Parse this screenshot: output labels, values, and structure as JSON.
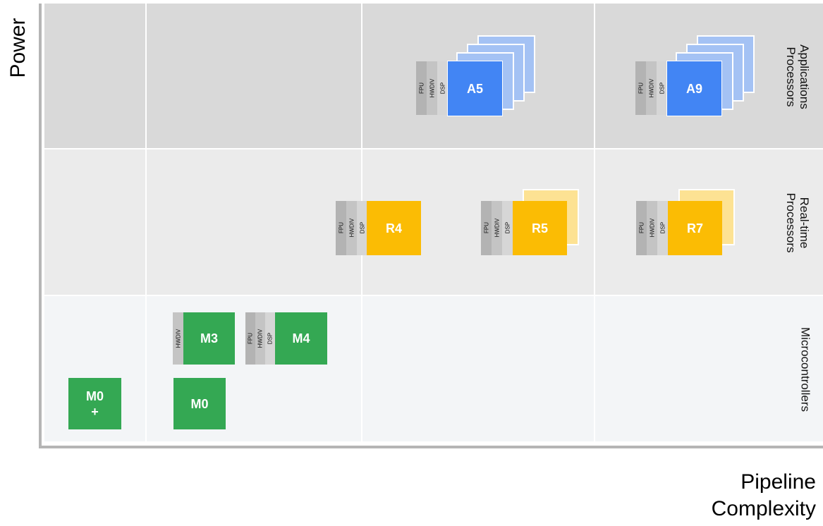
{
  "axes": {
    "y_title": "Power",
    "x_title_line1": "Pipeline",
    "x_title_line2": "Complexity"
  },
  "rows": {
    "applications_line1": "Applications",
    "applications_line2": "Processors",
    "realtime_line1": "Real-time",
    "realtime_line2": "Processors",
    "microcontrollers": "Microcontrollers"
  },
  "feature_labels": {
    "fpu": "FPU",
    "hwdiv": "HWDIV",
    "dsp": "DSP"
  },
  "cores": {
    "a5": "A5",
    "a9": "A9",
    "r4": "R4",
    "r5": "R5",
    "r7": "R7",
    "m3": "M3",
    "m4": "M4",
    "m0": "M0",
    "m0plus_line1": "M0",
    "m0plus_line2": "+"
  },
  "colors": {
    "application_core": "#4285f4",
    "application_stack": "#a4c2f4",
    "realtime_core": "#fbbc04",
    "realtime_stack": "#fde293",
    "microcontroller_core": "#34a853",
    "fpu_strip": "#b3b3b3",
    "hwdiv_strip": "#c4c4c4",
    "dsp_strip": "#d6d6d6"
  }
}
